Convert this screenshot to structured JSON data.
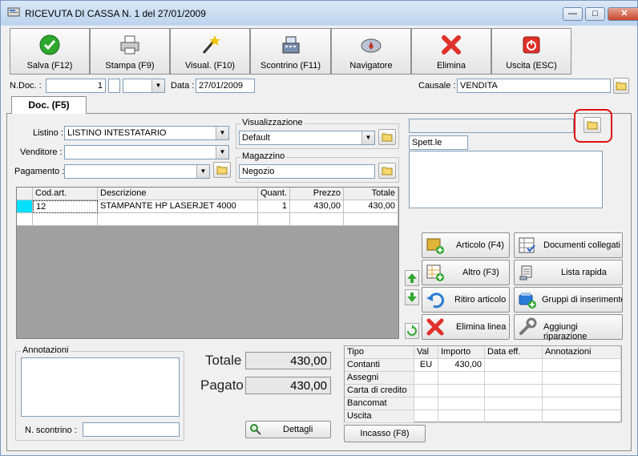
{
  "window": {
    "title": "RICEVUTA DI CASSA N. 1  del 27/01/2009",
    "controls": [
      "minimize",
      "maximize",
      "close"
    ]
  },
  "toolbar": {
    "salva": "Salva (F12)",
    "stampa": "Stampa (F9)",
    "visual": "Visual. (F10)",
    "scontrino": "Scontrino (F11)",
    "navigatore": "Navigatore",
    "elimina": "Elimina",
    "uscita": "Uscita (ESC)"
  },
  "header": {
    "ndoc_label": "N.Doc. :",
    "ndoc_value": "1",
    "data_label": "Data :",
    "data_value": "27/01/2009",
    "causale_label": "Causale :",
    "causale_value": "VENDITA"
  },
  "tab": {
    "label": "Doc. (F5)"
  },
  "form": {
    "listino_label": "Listino :",
    "listino_value": "LISTINO INTESTATARIO",
    "venditore_label": "Venditore :",
    "venditore_value": "",
    "pagamento_label": "Pagamento :",
    "pagamento_value": "",
    "visualizzazione_title": "Visualizzazione",
    "visualizzazione_value": "Default",
    "magazzino_title": "Magazzino",
    "magazzino_value": "Negozio",
    "cliente_value": "",
    "spett_value": "Spett.le",
    "address_value": ""
  },
  "grid": {
    "columns": [
      "Cod.art.",
      "Descrizione",
      "Quant.",
      "Prezzo",
      "Totale"
    ],
    "rows": [
      {
        "cod": "12",
        "descrizione": "STAMPANTE HP LASERJET 4000",
        "quant": "1",
        "prezzo": "430,00",
        "totale": "430,00"
      }
    ]
  },
  "actions": {
    "articolo": "Articolo (F4)",
    "documenti": "Documenti collegati",
    "altro": "Altro (F3)",
    "lista": "Lista rapida",
    "ritiro": "Ritiro articolo",
    "gruppi": "Gruppi di inserimento",
    "elimina_linea": "Elimina linea",
    "riparazione": "Aggiungi riparazione"
  },
  "annotazioni": {
    "title": "Annotazioni",
    "value": "",
    "scontrino_label": "N. scontrino :",
    "scontrino_value": ""
  },
  "totals": {
    "totale_label": "Totale",
    "totale_value": "430,00",
    "pagato_label": "Pagato",
    "pagato_value": "430,00",
    "dettagli": "Dettagli"
  },
  "payments": {
    "columns": [
      "Tipo",
      "Val",
      "Importo",
      "Data eff.",
      "Annotazioni"
    ],
    "rows": [
      {
        "tipo": "Contanti",
        "val": "EU",
        "importo": "430,00",
        "data": "",
        "note": ""
      },
      {
        "tipo": "Assegni",
        "val": "",
        "importo": "",
        "data": "",
        "note": ""
      },
      {
        "tipo": "Carta di credito",
        "val": "",
        "importo": "",
        "data": "",
        "note": ""
      },
      {
        "tipo": "Bancomat",
        "val": "",
        "importo": "",
        "data": "",
        "note": ""
      },
      {
        "tipo": "Uscita",
        "val": "",
        "importo": "",
        "data": "",
        "note": ""
      }
    ],
    "incasso": "Incasso (F8)"
  },
  "colors": {
    "title_bg": "#bcd3ee",
    "grid_bg": "#a0a0a0",
    "row_indicator": "#00e0ff",
    "highlight": "#e01010"
  }
}
